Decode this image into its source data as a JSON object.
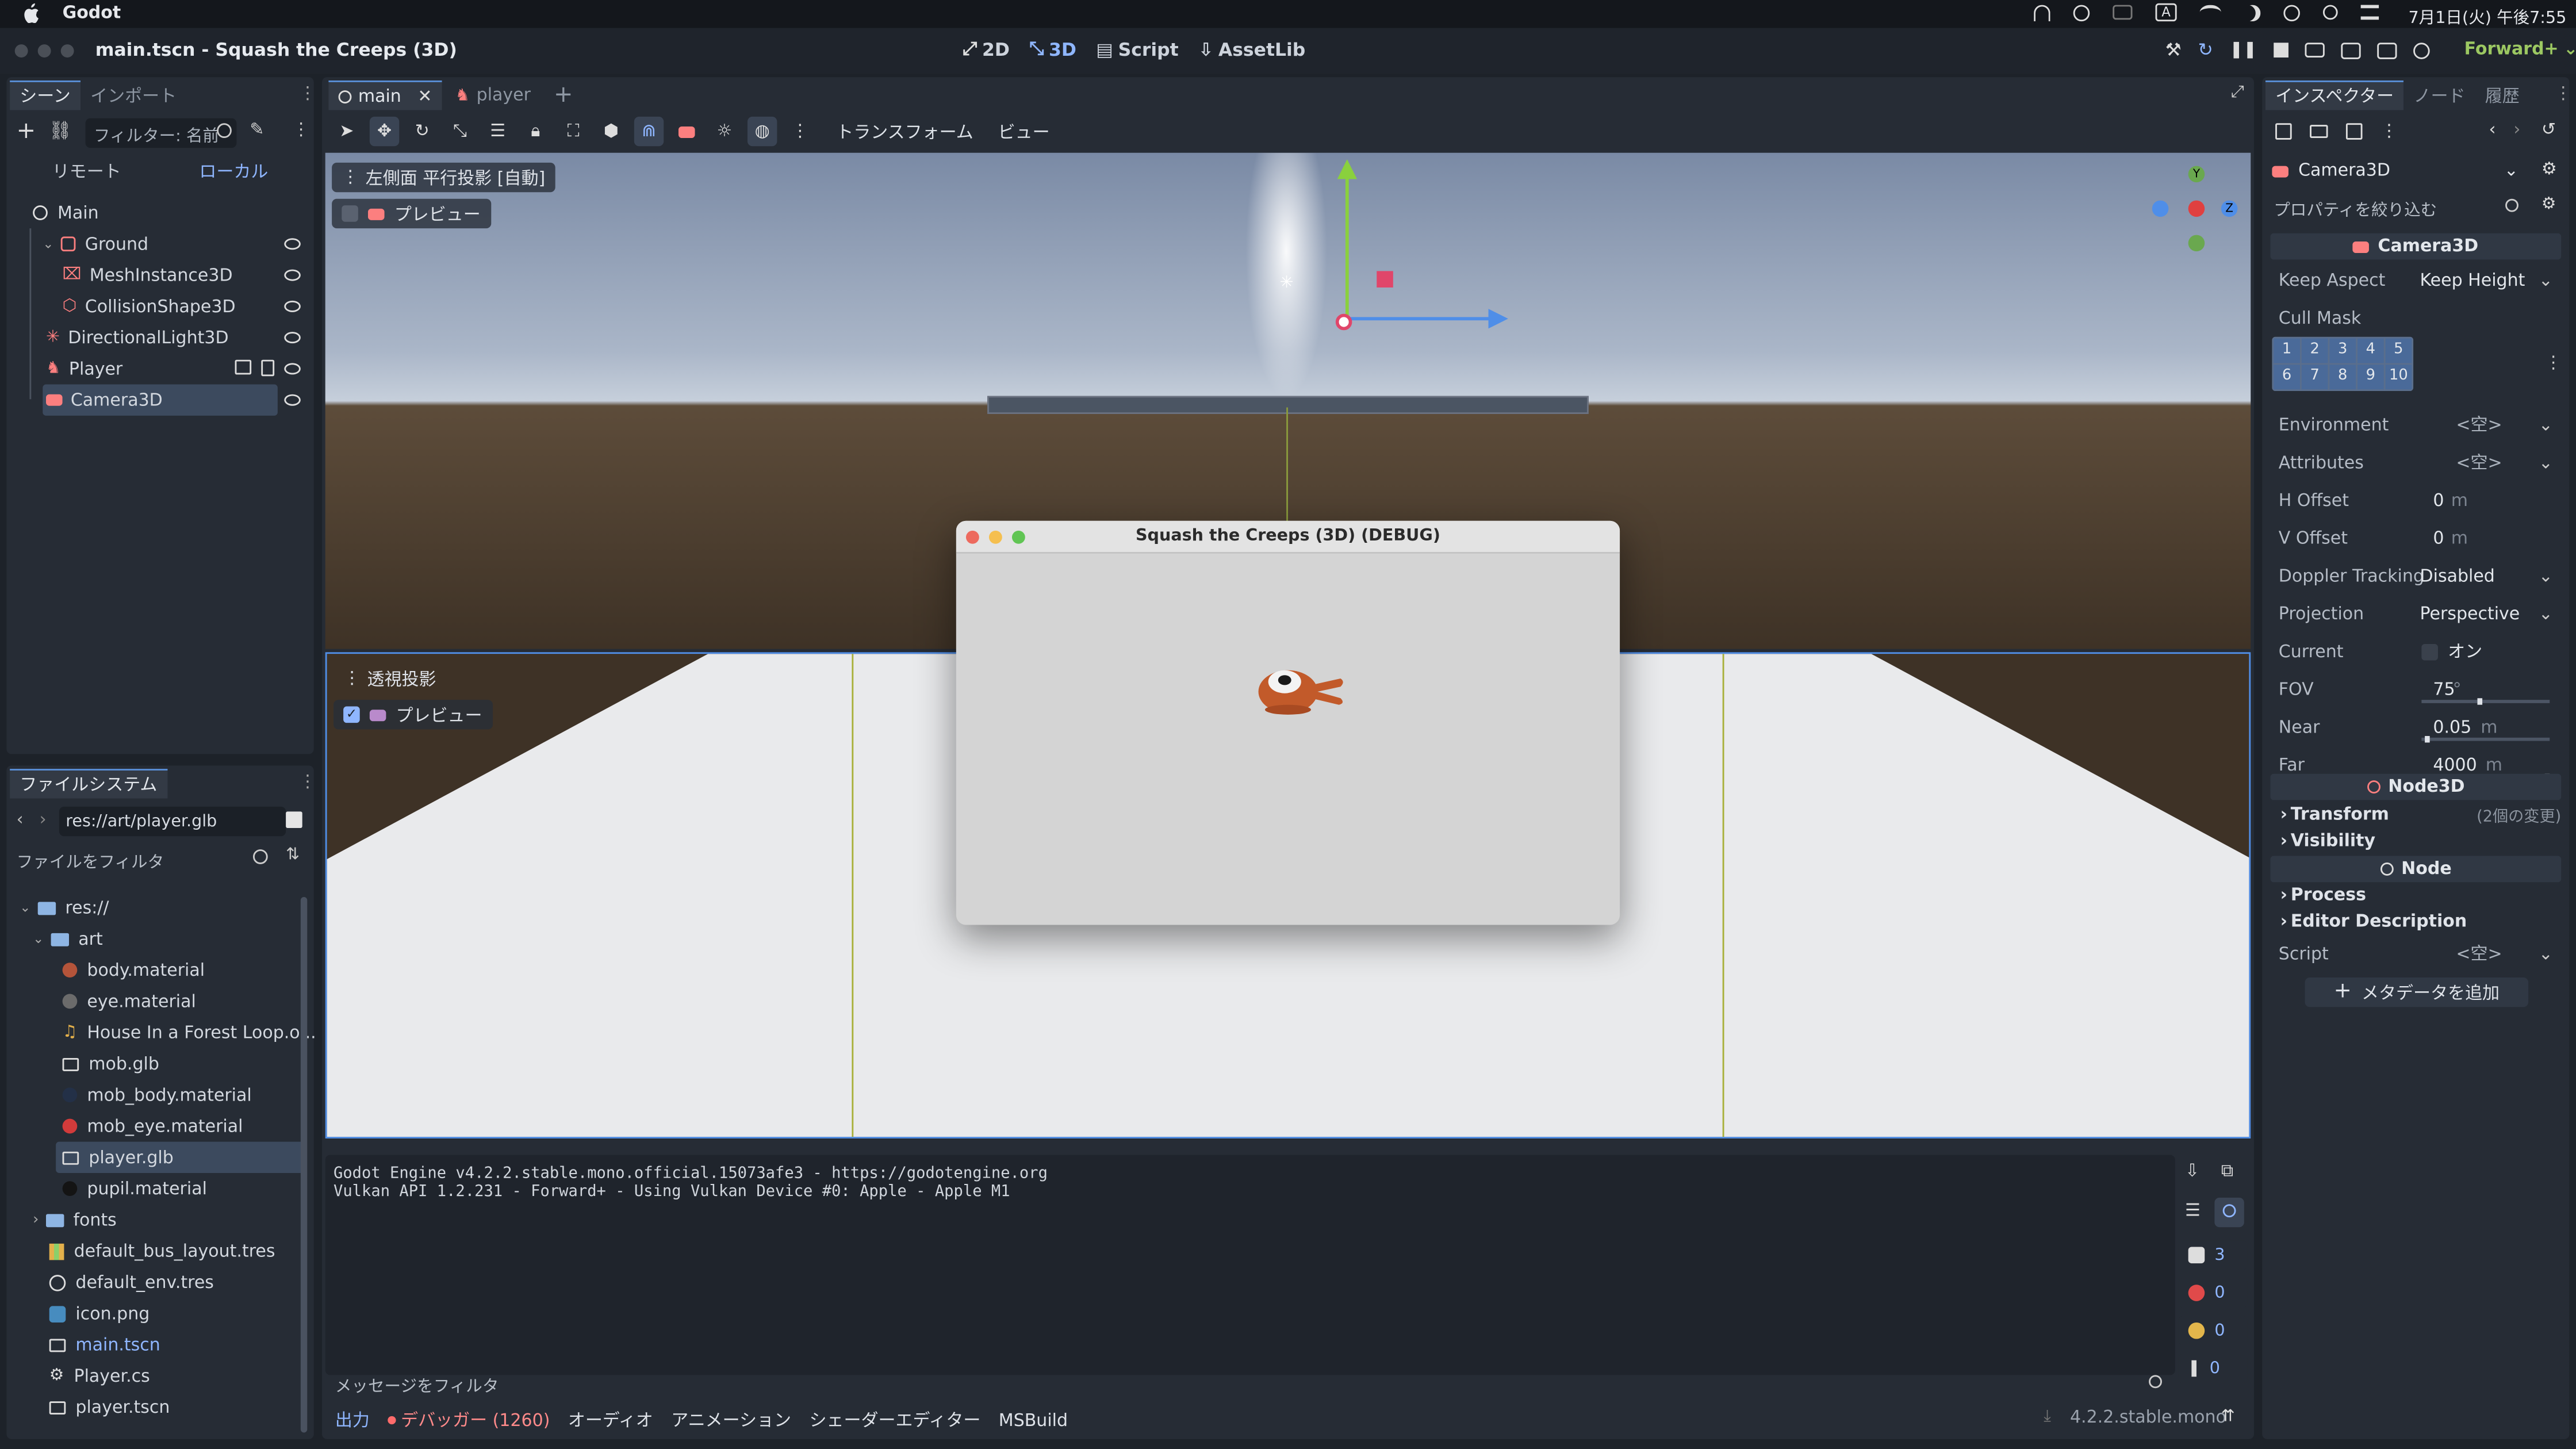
{
  "macos": {
    "app_name": "Godot",
    "clock": "7月1日(火) 午後7:55"
  },
  "window": {
    "title": "main.tscn - Squash the Creeps (3D)",
    "modes": [
      "2D",
      "3D",
      "Script",
      "AssetLib"
    ],
    "renderer": "Forward+"
  },
  "scene_dock": {
    "tabs": [
      "シーン",
      "インポート"
    ],
    "filter_placeholder": "フィルター: 名前",
    "remote_label": "リモート",
    "local_label": "ローカル",
    "nodes": [
      {
        "label": "Main"
      },
      {
        "label": "Ground"
      },
      {
        "label": "MeshInstance3D"
      },
      {
        "label": "CollisionShape3D"
      },
      {
        "label": "DirectionalLight3D"
      },
      {
        "label": "Player"
      },
      {
        "label": "Camera3D"
      }
    ]
  },
  "filesystem": {
    "title": "ファイルシステム",
    "path": "res://art/player.glb",
    "filter_placeholder": "ファイルをフィルタ",
    "items": [
      {
        "label": "res://"
      },
      {
        "label": "art"
      },
      {
        "label": "body.material"
      },
      {
        "label": "eye.material"
      },
      {
        "label": "House In a Forest Loop.o..."
      },
      {
        "label": "mob.glb"
      },
      {
        "label": "mob_body.material"
      },
      {
        "label": "mob_eye.material"
      },
      {
        "label": "player.glb"
      },
      {
        "label": "pupil.material"
      },
      {
        "label": "fonts"
      },
      {
        "label": "default_bus_layout.tres"
      },
      {
        "label": "default_env.tres"
      },
      {
        "label": "icon.png"
      },
      {
        "label": "main.tscn"
      },
      {
        "label": "Player.cs"
      },
      {
        "label": "player.tscn"
      }
    ]
  },
  "editor_tabs": [
    "main",
    "player"
  ],
  "viewport": {
    "menu_transform": "トランスフォーム",
    "menu_view": "ビュー",
    "top_label": "左側面 平行投影 [自動]",
    "top_preview": "プレビュー",
    "bottom_label": "透視投影",
    "bottom_preview": "プレビュー",
    "gizmo_axes": {
      "y": "Y",
      "z": "Z"
    },
    "debug_window_title": "Squash the Creeps (3D) (DEBUG)"
  },
  "output": {
    "lines": [
      "Godot Engine v4.2.2.stable.mono.official.15073afe3 - https://godotengine.org",
      "Vulkan API 1.2.231 - Forward+ - Using Vulkan Device #0: Apple - Apple M1"
    ],
    "filter_placeholder": "メッセージをフィルタ",
    "counts": {
      "messages": "3",
      "errors": "0",
      "warnings": "0",
      "info": "0"
    }
  },
  "bottom_tabs": {
    "output": "出力",
    "debugger": "デバッガー (1260)",
    "audio": "オーディオ",
    "animation": "アニメーション",
    "shader": "シェーダーエディター",
    "msbuild": "MSBuild",
    "version": "4.2.2.stable.mono"
  },
  "inspector": {
    "tabs": [
      "インスペクター",
      "ノード",
      "履歴"
    ],
    "node_name": "Camera3D",
    "filter_placeholder": "プロパティを絞り込む",
    "section_camera": "Camera3D",
    "keep_aspect": {
      "label": "Keep Aspect",
      "value": "Keep Height"
    },
    "cull_mask": {
      "label": "Cull Mask",
      "layers": [
        "1",
        "2",
        "3",
        "4",
        "5",
        "6",
        "7",
        "8",
        "9",
        "10"
      ]
    },
    "environment": {
      "label": "Environment",
      "value": "<空>"
    },
    "attributes": {
      "label": "Attributes",
      "value": "<空>"
    },
    "h_offset": {
      "label": "H Offset",
      "value": "0",
      "unit": "m"
    },
    "v_offset": {
      "label": "V Offset",
      "value": "0",
      "unit": "m"
    },
    "doppler": {
      "label": "Doppler Tracking",
      "value": "Disabled"
    },
    "projection": {
      "label": "Projection",
      "value": "Perspective"
    },
    "current": {
      "label": "Current",
      "value": "オン"
    },
    "fov": {
      "label": "FOV",
      "value": "75",
      "unit": "°"
    },
    "near": {
      "label": "Near",
      "value": "0.05",
      "unit": "m"
    },
    "far": {
      "label": "Far",
      "value": "4000",
      "unit": "m"
    },
    "section_node3d": "Node3D",
    "transform": {
      "label": "Transform",
      "note": "(2個の変更)"
    },
    "visibility": "Visibility",
    "section_node": "Node",
    "process": "Process",
    "editor_description": "Editor Description",
    "script": {
      "label": "Script",
      "value": "<空>"
    },
    "add_metadata": "メタデータを追加"
  }
}
